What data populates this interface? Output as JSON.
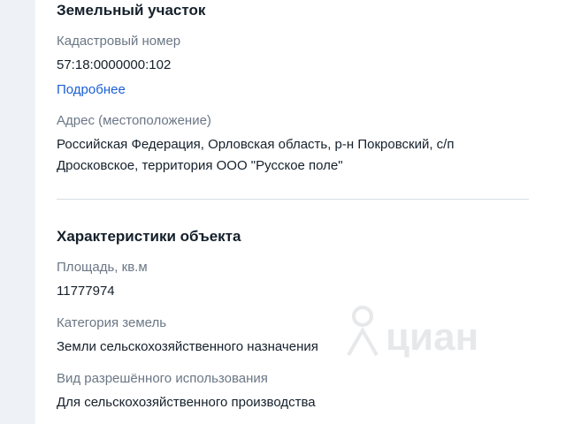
{
  "land_plot": {
    "title": "Земельный участок",
    "cadastral_label": "Кадастровый номер",
    "cadastral_value": "57:18:0000000:102",
    "more_link": "Подробнее",
    "address_label": "Адрес (местоположение)",
    "address_line1": "Российская Федерация, Орловская область, р-н Покровский, с/п",
    "address_line2": "Дросковское, территория ООО \"Русское поле\""
  },
  "characteristics": {
    "title": "Характеристики объекта",
    "area_label": "Площадь, кв.м",
    "area_value": "11777974",
    "category_label": "Категория земель",
    "category_value": "Земли сельскохозяйственного назначения",
    "usage_label": "Вид разрешённого использования",
    "usage_value": "Для сельскохозяйственного производства"
  },
  "watermark": {
    "brand": "циан",
    "icon": "cian-logo-icon"
  }
}
